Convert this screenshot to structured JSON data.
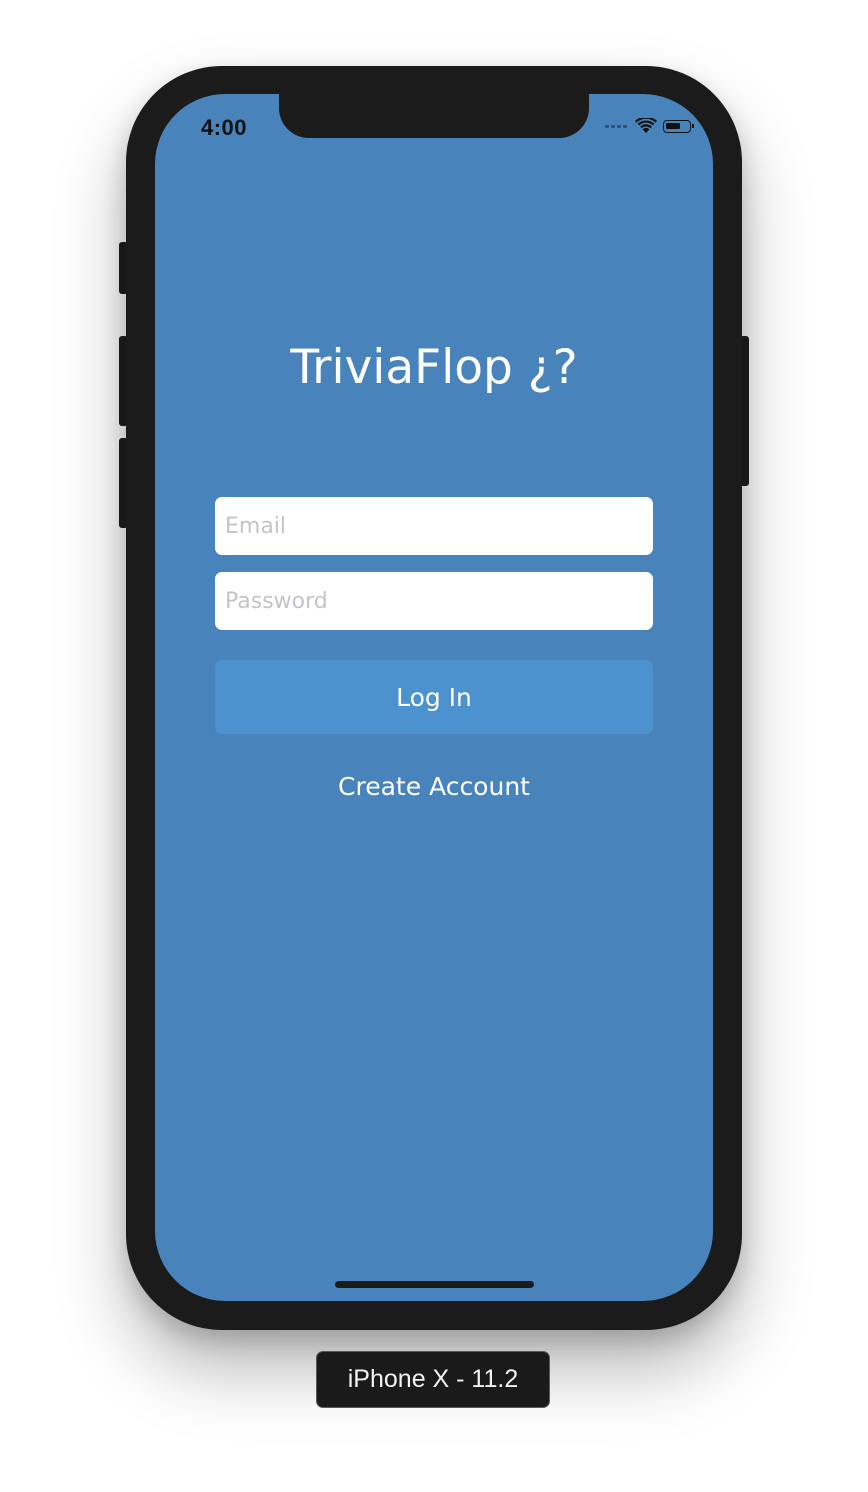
{
  "status_bar": {
    "time": "4:00",
    "icons": [
      "signal-dots-icon",
      "wifi-icon",
      "battery-icon"
    ]
  },
  "app": {
    "title": "TriviaFlop ¿?",
    "background_color": "#4884bb"
  },
  "form": {
    "email": {
      "placeholder": "Email",
      "value": ""
    },
    "password": {
      "placeholder": "Password",
      "value": ""
    },
    "login_label": "Log In",
    "login_button_color": "#4b92cf",
    "create_account_label": "Create Account"
  },
  "simulator": {
    "device_label": "iPhone X - 11.2"
  }
}
